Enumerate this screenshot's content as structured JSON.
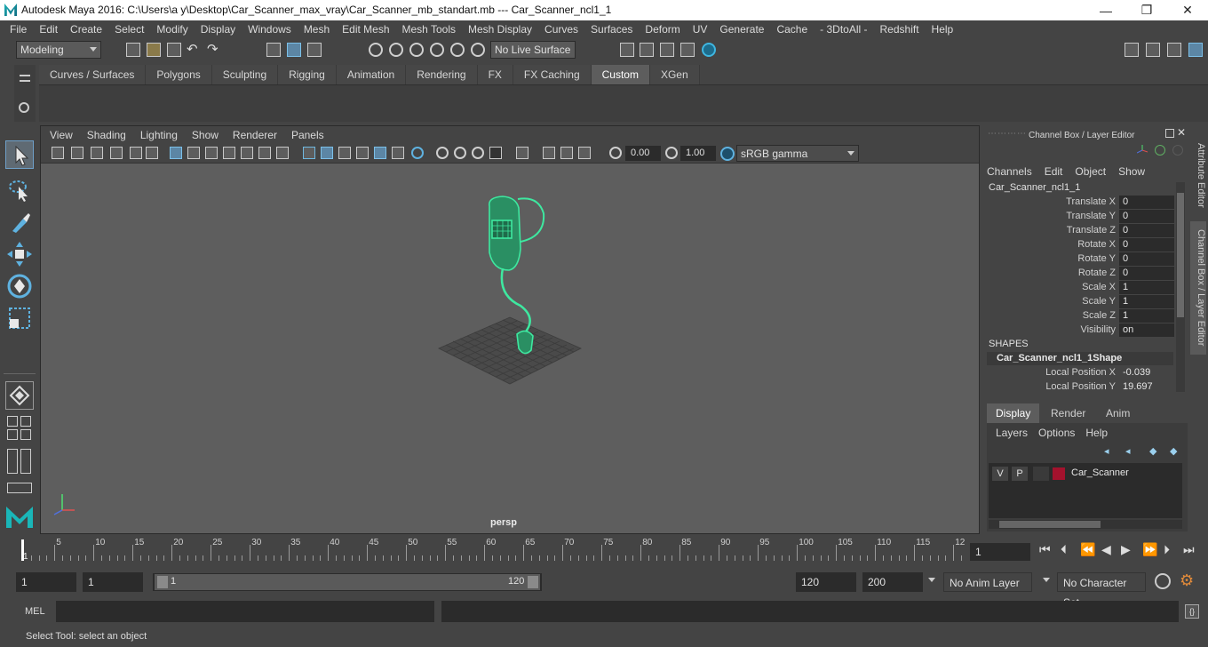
{
  "window": {
    "title": "Autodesk Maya 2016: C:\\Users\\a y\\Desktop\\Car_Scanner_max_vray\\Car_Scanner_mb_standart.mb   ---   Car_Scanner_ncl1_1",
    "minimize": "—",
    "maximize": "❐",
    "close": "✕"
  },
  "menubar": [
    "File",
    "Edit",
    "Create",
    "Select",
    "Modify",
    "Display",
    "Windows",
    "Mesh",
    "Edit Mesh",
    "Mesh Tools",
    "Mesh Display",
    "Curves",
    "Surfaces",
    "Deform",
    "UV",
    "Generate",
    "Cache",
    "- 3DtoAll -",
    "Redshift",
    "Help"
  ],
  "statusline": {
    "mode": "Modeling",
    "live_surface": "No Live Surface"
  },
  "shelf": {
    "tabs": [
      "Curves / Surfaces",
      "Polygons",
      "Sculpting",
      "Rigging",
      "Animation",
      "Rendering",
      "FX",
      "FX Caching",
      "Custom",
      "XGen"
    ],
    "active_tab": "Custom"
  },
  "viewport": {
    "menu": [
      "View",
      "Shading",
      "Lighting",
      "Show",
      "Renderer",
      "Panels"
    ],
    "exposure": "0.00",
    "gamma": "1.00",
    "color_space": "sRGB gamma",
    "camera_label": "persp"
  },
  "channel_box": {
    "title": "Channel Box / Layer Editor",
    "menu": [
      "Channels",
      "Edit",
      "Object",
      "Show"
    ],
    "object_name": "Car_Scanner_ncl1_1",
    "attributes": [
      {
        "name": "Translate X",
        "value": "0"
      },
      {
        "name": "Translate Y",
        "value": "0"
      },
      {
        "name": "Translate Z",
        "value": "0"
      },
      {
        "name": "Rotate X",
        "value": "0"
      },
      {
        "name": "Rotate Y",
        "value": "0"
      },
      {
        "name": "Rotate Z",
        "value": "0"
      },
      {
        "name": "Scale X",
        "value": "1"
      },
      {
        "name": "Scale Y",
        "value": "1"
      },
      {
        "name": "Scale Z",
        "value": "1"
      },
      {
        "name": "Visibility",
        "value": "on"
      }
    ],
    "shapes_header": "SHAPES",
    "shape_name": "Car_Scanner_ncl1_1Shape",
    "shape_attributes": [
      {
        "name": "Local Position X",
        "value": "-0.039"
      },
      {
        "name": "Local Position Y",
        "value": "19.697"
      }
    ]
  },
  "side_tabs": [
    "Attribute Editor",
    "Channel Box / Layer Editor"
  ],
  "layer_editor": {
    "tabs": [
      "Display",
      "Render",
      "Anim"
    ],
    "active_tab": "Display",
    "menu": [
      "Layers",
      "Options",
      "Help"
    ],
    "layers": [
      {
        "visible": "V",
        "playback": "P",
        "name": "Car_Scanner",
        "color": "#a3122d"
      }
    ]
  },
  "time_slider": {
    "ticks": [
      "5",
      "10",
      "15",
      "20",
      "25",
      "30",
      "35",
      "40",
      "45",
      "50",
      "55",
      "60",
      "65",
      "70",
      "75",
      "80",
      "85",
      "90",
      "95",
      "100",
      "105",
      "110",
      "115",
      "12"
    ],
    "start_marker": "1",
    "current_frame": "1"
  },
  "range_slider": {
    "start_time": "1",
    "playback_start": "1",
    "range_start": "1",
    "range_end": "120",
    "playback_end": "120",
    "end_time": "200",
    "anim_layer": "No Anim Layer",
    "character_set": "No Character Set"
  },
  "command_line": {
    "label": "MEL"
  },
  "help_line": "Select Tool: select an object",
  "colors": {
    "wireframe": "#3ee8a0",
    "accent": "#5d86a6"
  }
}
